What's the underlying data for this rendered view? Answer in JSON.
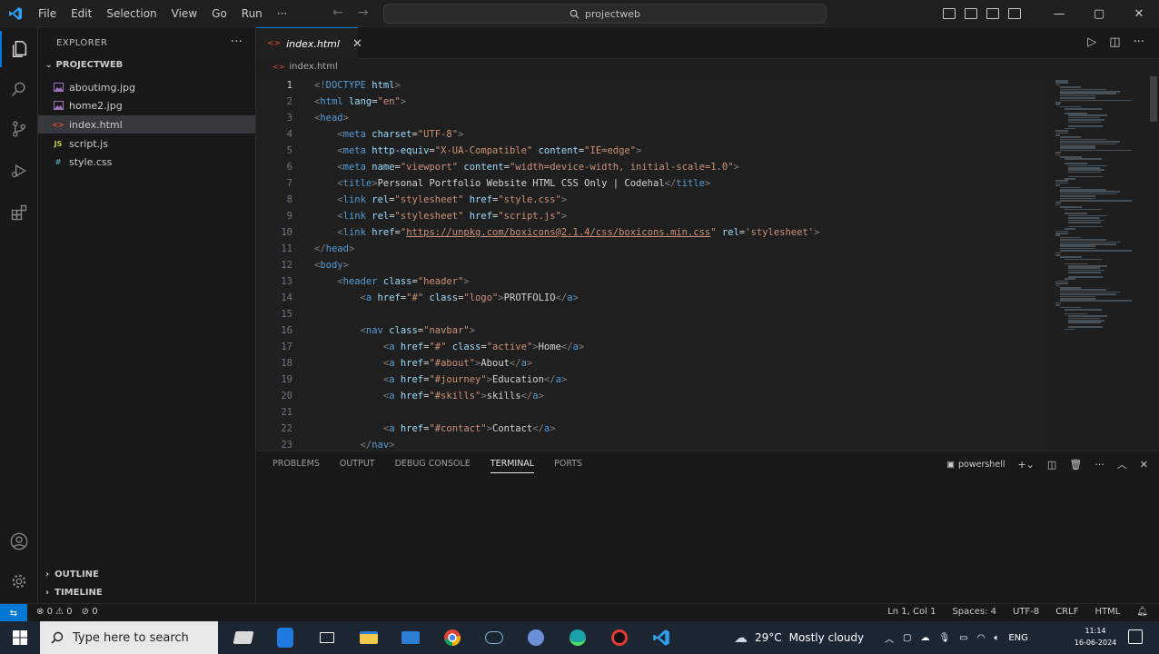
{
  "titlebar": {
    "menu": [
      "File",
      "Edit",
      "Selection",
      "View",
      "Go",
      "Run",
      "···"
    ],
    "search": "projectweb"
  },
  "explorer": {
    "title": "EXPLORER",
    "more": "···",
    "folder": "PROJECTWEB",
    "files": [
      {
        "name": "aboutimg.jpg",
        "icon": "image-icon",
        "color": "#a074c4"
      },
      {
        "name": "home2.jpg",
        "icon": "image-icon",
        "color": "#a074c4"
      },
      {
        "name": "index.html",
        "icon": "html-icon",
        "color": "#e44d26"
      },
      {
        "name": "script.js",
        "icon": "js-icon",
        "color": "#cbcb41"
      },
      {
        "name": "style.css",
        "icon": "css-icon",
        "color": "#519aba"
      }
    ],
    "outline": "OUTLINE",
    "timeline": "TIMELINE"
  },
  "editor": {
    "tab": "index.html",
    "breadcrumb": "index.html",
    "current_line": 1,
    "lines": [
      {
        "n": "1",
        "tokens": [
          [
            "t",
            "<!"
          ],
          [
            "tag",
            "DOCTYPE"
          ],
          [
            "attr",
            " html"
          ],
          [
            "t",
            ">"
          ]
        ]
      },
      {
        "n": "2",
        "tokens": [
          [
            "t",
            "<"
          ],
          [
            "tag",
            "html"
          ],
          [
            "attr",
            " lang"
          ],
          [
            "txt",
            "="
          ],
          [
            "str",
            "\"en\""
          ],
          [
            "t",
            ">"
          ]
        ]
      },
      {
        "n": "3",
        "tokens": [
          [
            "t",
            "<"
          ],
          [
            "tag",
            "head"
          ],
          [
            "t",
            ">"
          ]
        ]
      },
      {
        "n": "4",
        "tokens": [
          [
            "txt",
            "    "
          ],
          [
            "t",
            "<"
          ],
          [
            "tag",
            "meta"
          ],
          [
            "attr",
            " charset"
          ],
          [
            "txt",
            "="
          ],
          [
            "str",
            "\"UTF-8\""
          ],
          [
            "t",
            ">"
          ]
        ]
      },
      {
        "n": "5",
        "tokens": [
          [
            "txt",
            "    "
          ],
          [
            "t",
            "<"
          ],
          [
            "tag",
            "meta"
          ],
          [
            "attr",
            " http-equiv"
          ],
          [
            "txt",
            "="
          ],
          [
            "str",
            "\"X-UA-Compatible\""
          ],
          [
            "attr",
            " content"
          ],
          [
            "txt",
            "="
          ],
          [
            "str",
            "\"IE=edge\""
          ],
          [
            "t",
            ">"
          ]
        ]
      },
      {
        "n": "6",
        "tokens": [
          [
            "txt",
            "    "
          ],
          [
            "t",
            "<"
          ],
          [
            "tag",
            "meta"
          ],
          [
            "attr",
            " name"
          ],
          [
            "txt",
            "="
          ],
          [
            "str",
            "\"viewport\""
          ],
          [
            "attr",
            " content"
          ],
          [
            "txt",
            "="
          ],
          [
            "str",
            "\"width=device-width, initial-scale=1.0\""
          ],
          [
            "t",
            ">"
          ]
        ]
      },
      {
        "n": "7",
        "tokens": [
          [
            "txt",
            "    "
          ],
          [
            "t",
            "<"
          ],
          [
            "tag",
            "title"
          ],
          [
            "t",
            ">"
          ],
          [
            "txt",
            "Personal Portfolio Website HTML CSS Only | Codehal"
          ],
          [
            "t",
            "</"
          ],
          [
            "tag",
            "title"
          ],
          [
            "t",
            ">"
          ]
        ]
      },
      {
        "n": "8",
        "tokens": [
          [
            "txt",
            "    "
          ],
          [
            "t",
            "<"
          ],
          [
            "tag",
            "link"
          ],
          [
            "attr",
            " rel"
          ],
          [
            "txt",
            "="
          ],
          [
            "str",
            "\"stylesheet\""
          ],
          [
            "attr",
            " href"
          ],
          [
            "txt",
            "="
          ],
          [
            "str",
            "\"style.css\""
          ],
          [
            "t",
            ">"
          ]
        ]
      },
      {
        "n": "9",
        "tokens": [
          [
            "txt",
            "    "
          ],
          [
            "t",
            "<"
          ],
          [
            "tag",
            "link"
          ],
          [
            "attr",
            " rel"
          ],
          [
            "txt",
            "="
          ],
          [
            "str",
            "\"stylesheet\""
          ],
          [
            "attr",
            " href"
          ],
          [
            "txt",
            "="
          ],
          [
            "str",
            "\"script.js\""
          ],
          [
            "t",
            ">"
          ]
        ]
      },
      {
        "n": "10",
        "tokens": [
          [
            "txt",
            "    "
          ],
          [
            "t",
            "<"
          ],
          [
            "tag",
            "link"
          ],
          [
            "attr",
            " href"
          ],
          [
            "txt",
            "="
          ],
          [
            "str",
            "\""
          ],
          [
            "url",
            "https://unpkg.com/boxicons@2.1.4/css/boxicons.min.css"
          ],
          [
            "str",
            "\""
          ],
          [
            "attr",
            " rel"
          ],
          [
            "txt",
            "="
          ],
          [
            "str",
            "'stylesheet'"
          ],
          [
            "t",
            ">"
          ]
        ]
      },
      {
        "n": "11",
        "tokens": [
          [
            "t",
            "</"
          ],
          [
            "tag",
            "head"
          ],
          [
            "t",
            ">"
          ]
        ]
      },
      {
        "n": "12",
        "tokens": [
          [
            "t",
            "<"
          ],
          [
            "tag",
            "body"
          ],
          [
            "t",
            ">"
          ]
        ]
      },
      {
        "n": "13",
        "tokens": [
          [
            "txt",
            "    "
          ],
          [
            "t",
            "<"
          ],
          [
            "tag",
            "header"
          ],
          [
            "attr",
            " class"
          ],
          [
            "txt",
            "="
          ],
          [
            "str",
            "\"header\""
          ],
          [
            "t",
            ">"
          ]
        ]
      },
      {
        "n": "14",
        "tokens": [
          [
            "txt",
            "        "
          ],
          [
            "t",
            "<"
          ],
          [
            "tag",
            "a"
          ],
          [
            "attr",
            " href"
          ],
          [
            "txt",
            "="
          ],
          [
            "str",
            "\"#\""
          ],
          [
            "attr",
            " class"
          ],
          [
            "txt",
            "="
          ],
          [
            "str",
            "\"logo\""
          ],
          [
            "t",
            ">"
          ],
          [
            "txt",
            "PROTFOLIO"
          ],
          [
            "t",
            "</"
          ],
          [
            "tag",
            "a"
          ],
          [
            "t",
            ">"
          ]
        ]
      },
      {
        "n": "15",
        "tokens": []
      },
      {
        "n": "16",
        "tokens": [
          [
            "txt",
            "        "
          ],
          [
            "t",
            "<"
          ],
          [
            "tag",
            "nav"
          ],
          [
            "attr",
            " class"
          ],
          [
            "txt",
            "="
          ],
          [
            "str",
            "\"navbar\""
          ],
          [
            "t",
            ">"
          ]
        ]
      },
      {
        "n": "17",
        "tokens": [
          [
            "txt",
            "            "
          ],
          [
            "t",
            "<"
          ],
          [
            "tag",
            "a"
          ],
          [
            "attr",
            " href"
          ],
          [
            "txt",
            "="
          ],
          [
            "str",
            "\"#\""
          ],
          [
            "attr",
            " class"
          ],
          [
            "txt",
            "="
          ],
          [
            "str",
            "\"active\""
          ],
          [
            "t",
            ">"
          ],
          [
            "txt",
            "Home"
          ],
          [
            "t",
            "</"
          ],
          [
            "tag",
            "a"
          ],
          [
            "t",
            ">"
          ]
        ]
      },
      {
        "n": "18",
        "tokens": [
          [
            "txt",
            "            "
          ],
          [
            "t",
            "<"
          ],
          [
            "tag",
            "a"
          ],
          [
            "attr",
            " href"
          ],
          [
            "txt",
            "="
          ],
          [
            "str",
            "\"#about\""
          ],
          [
            "t",
            ">"
          ],
          [
            "txt",
            "About"
          ],
          [
            "t",
            "</"
          ],
          [
            "tag",
            "a"
          ],
          [
            "t",
            ">"
          ]
        ]
      },
      {
        "n": "19",
        "tokens": [
          [
            "txt",
            "            "
          ],
          [
            "t",
            "<"
          ],
          [
            "tag",
            "a"
          ],
          [
            "attr",
            " href"
          ],
          [
            "txt",
            "="
          ],
          [
            "str",
            "\"#journey\""
          ],
          [
            "t",
            ">"
          ],
          [
            "txt",
            "Education"
          ],
          [
            "t",
            "</"
          ],
          [
            "tag",
            "a"
          ],
          [
            "t",
            ">"
          ]
        ]
      },
      {
        "n": "20",
        "tokens": [
          [
            "txt",
            "            "
          ],
          [
            "t",
            "<"
          ],
          [
            "tag",
            "a"
          ],
          [
            "attr",
            " href"
          ],
          [
            "txt",
            "="
          ],
          [
            "str",
            "\"#skills\""
          ],
          [
            "t",
            ">"
          ],
          [
            "txt",
            "skills"
          ],
          [
            "t",
            "</"
          ],
          [
            "tag",
            "a"
          ],
          [
            "t",
            ">"
          ]
        ]
      },
      {
        "n": "21",
        "tokens": []
      },
      {
        "n": "22",
        "tokens": [
          [
            "txt",
            "            "
          ],
          [
            "t",
            "<"
          ],
          [
            "tag",
            "a"
          ],
          [
            "attr",
            " href"
          ],
          [
            "txt",
            "="
          ],
          [
            "str",
            "\"#contact\""
          ],
          [
            "t",
            ">"
          ],
          [
            "txt",
            "Contact"
          ],
          [
            "t",
            "</"
          ],
          [
            "tag",
            "a"
          ],
          [
            "t",
            ">"
          ]
        ]
      },
      {
        "n": "23",
        "tokens": [
          [
            "txt",
            "        "
          ],
          [
            "t",
            "</"
          ],
          [
            "tag",
            "nav"
          ],
          [
            "t",
            ">"
          ]
        ]
      }
    ]
  },
  "panel": {
    "tabs": [
      "PROBLEMS",
      "OUTPUT",
      "DEBUG CONSOLE",
      "TERMINAL",
      "PORTS"
    ],
    "active_tab": "TERMINAL",
    "shell": "powershell"
  },
  "statusbar": {
    "errors": "0",
    "warnings": "0",
    "ports": "0",
    "position": "Ln 1, Col 1",
    "spaces": "Spaces: 4",
    "encoding": "UTF-8",
    "eol": "CRLF",
    "language": "HTML"
  },
  "taskbar": {
    "search_placeholder": "Type here to search",
    "temperature": "29°C",
    "weather": "Mostly cloudy",
    "language": "ENG",
    "time": "11:14",
    "date": "16-06-2024"
  },
  "colors": {
    "accent": "#0078d4",
    "editor_bg": "#1f1f1f",
    "sidebar_bg": "#181818",
    "taskbar_bg": "#1c2633"
  }
}
